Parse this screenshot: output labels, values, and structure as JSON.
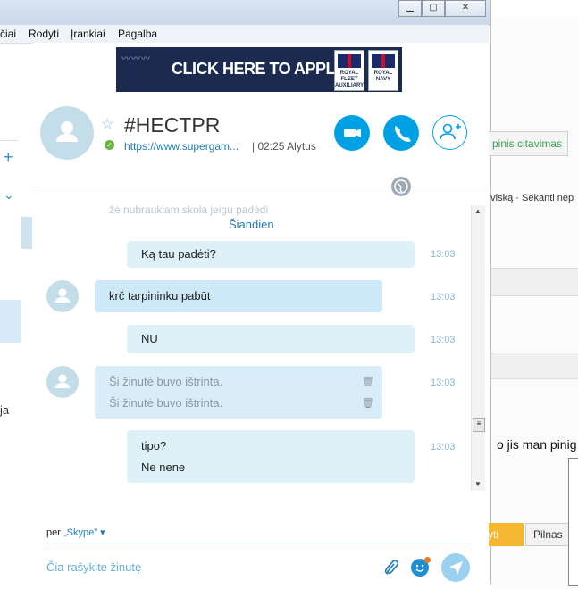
{
  "background_left": {
    "fragment": "ja"
  },
  "background_right": {
    "btn_green": "pinis citavimas",
    "links_text": "e viską · Sekanti nep",
    "msg_fragment": "o jis man pinig",
    "btn_yellow": "yti",
    "btn_grey": "Pilnas"
  },
  "menubar": {
    "items": [
      "čiai",
      "Rodyti",
      "Įrankiai",
      "Pagalba"
    ]
  },
  "ad": {
    "text": "CLICK HERE TO APPLY",
    "badge1": "ROYAL FLEET AUXILIARY",
    "badge2": "ROYAL NAVY"
  },
  "header": {
    "title": "#HECTPR",
    "link": "https://www.supergam...",
    "meta": "| 02:25 Alytus"
  },
  "chat": {
    "faded_text": "žė nubraukiam skola jeigu padėdi",
    "day_label": "Šiandien",
    "messages": [
      {
        "dir": "out",
        "lines": [
          "Ką tau padėti?"
        ],
        "time": "13:03"
      },
      {
        "dir": "in",
        "lines": [
          "krč tarpininku pabūt"
        ],
        "time": "13:03"
      },
      {
        "dir": "out",
        "lines": [
          "NU"
        ],
        "time": "13:03"
      },
      {
        "dir": "in",
        "lines": [
          "Ši žinutė buvo ištrinta.",
          "Ši žinutė buvo ištrinta."
        ],
        "time": "13:03",
        "deleted": true
      },
      {
        "dir": "out",
        "lines": [
          "tipo?",
          "Ne nene"
        ],
        "time": "13:03"
      }
    ]
  },
  "compose": {
    "via_prefix": "per",
    "via_service": "„Skype\"",
    "placeholder": "Čia rašykite žinutę"
  },
  "colors": {
    "accent": "#00a0e4",
    "bubble_out": "#def0f8",
    "bubble_in": "#cde9f7",
    "online": "#6ab53f"
  }
}
